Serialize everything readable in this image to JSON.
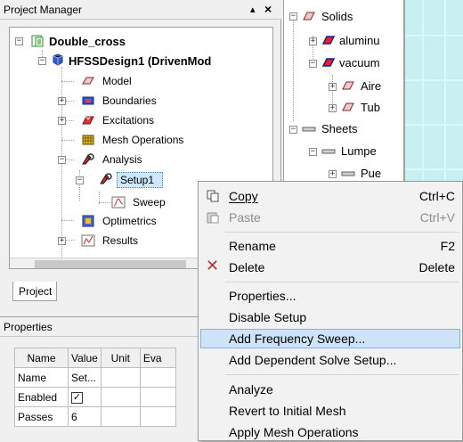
{
  "project_manager": {
    "title": "Project Manager",
    "pin_glyph": "▴",
    "close_glyph": "×",
    "tab_label": "Project",
    "tree": {
      "project": "Double_cross",
      "design": "HFSSDesign1 (DrivenMod",
      "items": [
        "Model",
        "Boundaries",
        "Excitations",
        "Mesh Operations",
        "Analysis"
      ],
      "setup": "Setup1",
      "sweep": "Sweep",
      "after": [
        "Optimetrics",
        "Results"
      ]
    }
  },
  "properties": {
    "title": "Properties",
    "columns": [
      "Name",
      "Value",
      "Unit",
      "Eva"
    ],
    "rows": [
      {
        "name": "Name",
        "value": "Set..."
      },
      {
        "name": "Enabled",
        "value": "✓"
      },
      {
        "name": "Passes",
        "value": "6"
      }
    ]
  },
  "model_tree": {
    "solids": "Solids",
    "material1": "aluminu",
    "material2": "vacuum",
    "obj1": "Aire",
    "obj2": "Tub",
    "sheets": "Sheets",
    "lumped": "Lumpe",
    "port": "Pue"
  },
  "context_menu": {
    "items": [
      {
        "label": "Copy",
        "shortcut": "Ctrl+C",
        "enabled": true
      },
      {
        "label": "Paste",
        "shortcut": "Ctrl+V",
        "enabled": false
      },
      {
        "label": "Rename",
        "shortcut": "F2",
        "enabled": true
      },
      {
        "label": "Delete",
        "shortcut": "Delete",
        "enabled": true
      },
      {
        "label": "Properties...",
        "shortcut": "",
        "enabled": true
      },
      {
        "label": "Disable Setup",
        "shortcut": "",
        "enabled": true
      },
      {
        "label": "Add Frequency Sweep...",
        "shortcut": "",
        "enabled": true,
        "highlighted": true
      },
      {
        "label": "Add Dependent Solve Setup...",
        "shortcut": "",
        "enabled": true
      },
      {
        "label": "Analyze",
        "shortcut": "",
        "enabled": true
      },
      {
        "label": "Revert to Initial Mesh",
        "shortcut": "",
        "enabled": true
      },
      {
        "label": "Apply Mesh Operations",
        "shortcut": "",
        "enabled": true
      }
    ]
  },
  "colors": {
    "highlight_bg": "#cce4f7",
    "highlight_border": "#7eb4ea",
    "selection_bg": "#cde8ff",
    "viewport_bg": "#c8f0f0"
  }
}
